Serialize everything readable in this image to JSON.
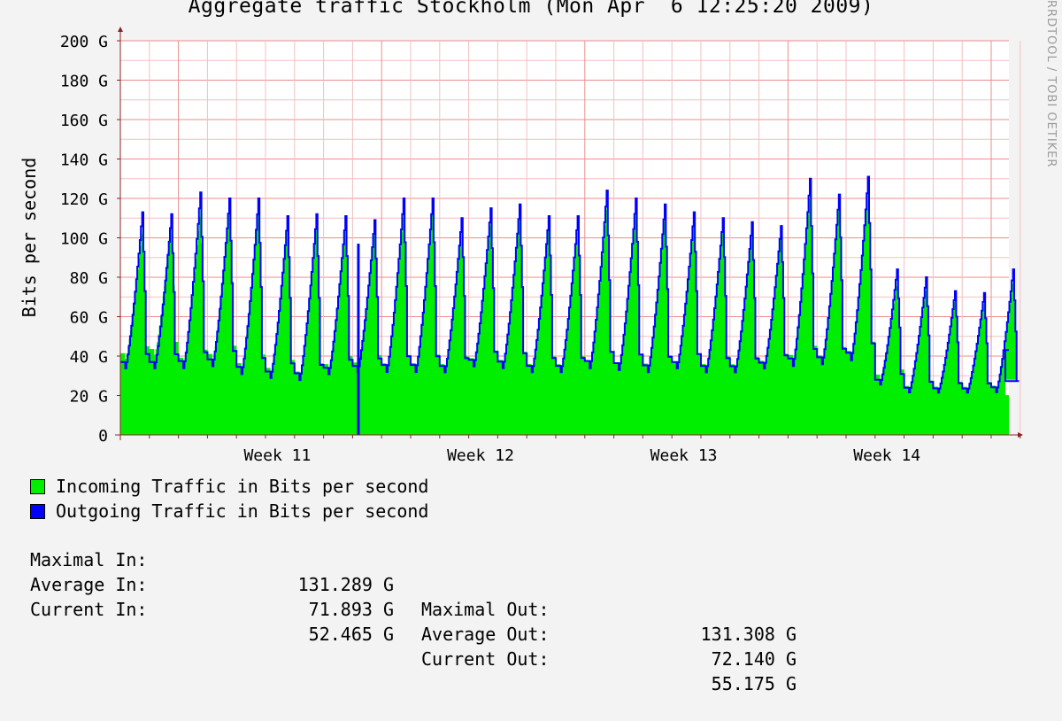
{
  "title": "Aggregate traffic Stockholm (Mon Apr  6 12:25:20 2009)",
  "watermark": "RRDTOOL / TOBI OETIKER",
  "colors": {
    "background": "#f3f3f3",
    "plot_bg": "#ffffff",
    "grid_minor": "#f2c0c0",
    "grid_major": "#ec8e8e",
    "axis": "#8b2323",
    "incoming": "#00ee00",
    "outgoing": "#0000ff"
  },
  "chart_data": {
    "type": "area",
    "ylabel": "Bits per second",
    "y_ticks": [
      "0",
      "20 G",
      "40 G",
      "60 G",
      "80 G",
      "100 G",
      "120 G",
      "140 G",
      "160 G",
      "180 G",
      "200 G"
    ],
    "ylim": [
      0,
      200
    ],
    "x_ticks": [
      "Week 11",
      "Week 12",
      "Week 13",
      "Week 14"
    ],
    "grid": true,
    "x_days": [
      0,
      1,
      2,
      3,
      4,
      5,
      6,
      7,
      8,
      9,
      10,
      11,
      12,
      13,
      14,
      15,
      16,
      17,
      18,
      19,
      20,
      21,
      22,
      23,
      24,
      25,
      26,
      27,
      28,
      29,
      30
    ],
    "incoming_peaks": [
      108,
      112,
      118,
      119,
      120,
      110,
      111,
      110,
      108,
      118,
      120,
      110,
      113,
      116,
      111,
      110,
      122,
      119,
      116,
      113,
      110,
      108,
      106,
      128,
      122,
      131,
      80,
      78,
      72,
      71,
      82
    ],
    "incoming_troughs": [
      38,
      40,
      35,
      37,
      32,
      30,
      28,
      32,
      33,
      32,
      32,
      32,
      35,
      34,
      32,
      32,
      33,
      32,
      32,
      33,
      32,
      32,
      34,
      36,
      36,
      38,
      28,
      22,
      22,
      22,
      22
    ],
    "outgoing_peaks": [
      113,
      112,
      123,
      120,
      120,
      111,
      112,
      111,
      109,
      120,
      120,
      110,
      115,
      117,
      111,
      111,
      124,
      120,
      117,
      113,
      110,
      108,
      106,
      130,
      122,
      131,
      84,
      80,
      73,
      72,
      84
    ],
    "outgoing_troughs": [
      33,
      33,
      33,
      34,
      30,
      28,
      27,
      30,
      31,
      31,
      31,
      31,
      34,
      33,
      31,
      31,
      33,
      32,
      31,
      33,
      31,
      31,
      33,
      34,
      35,
      37,
      25,
      21,
      21,
      21,
      21
    ],
    "current_in": 20,
    "current_out": 43,
    "series": [
      {
        "name": "Incoming Traffic in Bits per second",
        "color": "#00ee00"
      },
      {
        "name": "Outgoing Traffic in Bits per second",
        "color": "#0000ff"
      }
    ]
  },
  "legend": {
    "incoming": "Incoming Traffic in Bits per second",
    "outgoing": "Outgoing Traffic in Bits per second"
  },
  "stats": {
    "max_in_label": "Maximal In:",
    "max_in": "131.289 G",
    "max_out_label": "Maximal Out:",
    "max_out": "131.308 G",
    "avg_in_label": "Average In:",
    "avg_in": "71.893 G",
    "avg_out_label": "Average Out:",
    "avg_out": "72.140 G",
    "cur_in_label": "Current In:",
    "cur_in": "52.465 G",
    "cur_out_label": "Current Out:",
    "cur_out": "55.175 G"
  }
}
